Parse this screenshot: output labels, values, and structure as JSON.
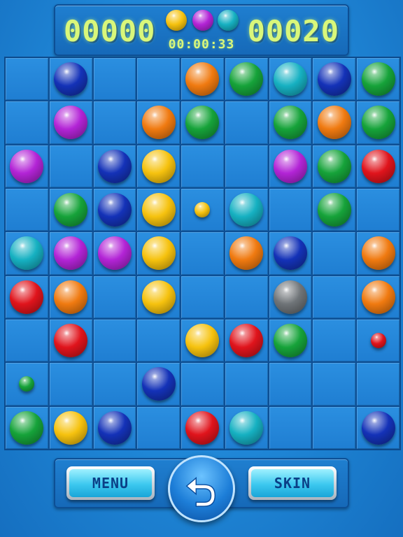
{
  "header": {
    "score_left": "00000",
    "score_right": "00020",
    "timer": "00:00:33",
    "next_balls": [
      "yellow",
      "purple",
      "cyan"
    ]
  },
  "colors": {
    "red": "#e0141c",
    "orange": "#f07a10",
    "yellow": "#f6c20e",
    "green": "#16a33a",
    "cyan": "#16b1c2",
    "blue": "#1432b8",
    "purple": "#b324d6",
    "gray": "#6f7478"
  },
  "board": {
    "rows": [
      [
        null,
        "blue",
        null,
        null,
        "orange",
        "green",
        "cyan",
        "blue",
        "green"
      ],
      [
        null,
        "purple",
        null,
        "orange",
        "green",
        null,
        "green",
        "orange",
        "green"
      ],
      [
        "purple",
        null,
        "blue",
        "yellow",
        null,
        null,
        "purple",
        "green",
        "red"
      ],
      [
        null,
        "green",
        "blue",
        "yellow",
        "yellow-small",
        "cyan",
        null,
        "green",
        null
      ],
      [
        "cyan",
        "purple",
        "purple",
        "yellow",
        null,
        "orange",
        "blue",
        null,
        "orange"
      ],
      [
        "red",
        "orange",
        null,
        "yellow",
        null,
        null,
        "gray",
        null,
        "orange"
      ],
      [
        null,
        "red",
        null,
        null,
        "yellow",
        "red",
        "green",
        null,
        "red-small"
      ],
      [
        "green-small",
        null,
        null,
        "blue",
        null,
        null,
        null,
        null,
        null
      ],
      [
        "green",
        "yellow",
        "blue",
        null,
        "red",
        "cyan",
        null,
        null,
        "blue"
      ]
    ]
  },
  "controls": {
    "menu_label": "MENU",
    "skin_label": "SKIN",
    "undo_icon": "undo-arrow-icon"
  }
}
